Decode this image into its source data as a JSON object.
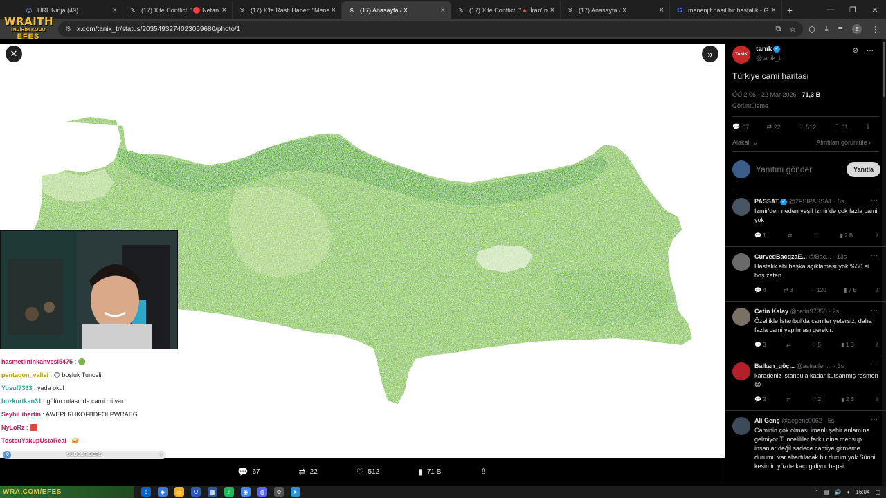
{
  "browser": {
    "tabs": [
      {
        "title": "URL Ninja (49)",
        "icon": "globe-icon",
        "active": false
      },
      {
        "title": "(17) X'te Conflict: \"🔴 Netanyahu",
        "icon": "x-icon",
        "active": false
      },
      {
        "title": "(17) X'te Rasti Haber: \"Menenjit",
        "icon": "x-icon",
        "active": false
      },
      {
        "title": "(17) Anasayfa / X",
        "icon": "x-icon",
        "active": true
      },
      {
        "title": "(17) X'te Conflict: \"🔺 İran'ın ba",
        "icon": "x-icon",
        "active": false
      },
      {
        "title": "(17) Anasayfa / X",
        "icon": "x-icon",
        "active": false
      },
      {
        "title": "menenjit nasıl bir hastalık - Goo",
        "icon": "google-icon",
        "active": false
      }
    ],
    "url": "x.com/tanik_tr/status/2035493274023059680/photo/1",
    "profile_initial": "E"
  },
  "overlay": {
    "brand_line1": "WRAITH",
    "brand_line2": "İNDİRİM KODU",
    "brand_line3": "EFES"
  },
  "media_actions": {
    "replies": "67",
    "reposts": "22",
    "likes": "512",
    "views": "71 B"
  },
  "post": {
    "author_name": "tanık",
    "author_handle": "@tanik_tr",
    "avatar_text": "TANIK",
    "text": "Türkiye cami haritası",
    "time": "ÖÖ 2:06 · 22 Mar 2026 · ",
    "views_count": "71,3 B",
    "views_label": "Görüntüleme",
    "replies": "67",
    "reposts": "22",
    "likes": "512",
    "bookmarks": "61",
    "sort_label": "Alakalı",
    "quotes_label": "Alıntıları görüntüle",
    "reply_placeholder": "Yanıtını gönder",
    "reply_button": "Yanıtla"
  },
  "replies": [
    {
      "name": "PASSAT",
      "handle": "@2FSIPASSAT · 6s",
      "verified": true,
      "text": "İzmir'den neden yeşil İzmir'de çok fazla cami yok",
      "replies": "1",
      "reposts": "",
      "likes": "",
      "views": "2 B",
      "avatar_color": "#4a5563"
    },
    {
      "name": "CurvedBacqzaE...",
      "handle": "@Bac... · 13s",
      "verified": false,
      "text": "Hastalık abi başka açıklaması yok.%50 si boş zaten",
      "replies": "4",
      "reposts": "3",
      "likes": "120",
      "views": "7 B",
      "avatar_color": "#6a6a6a"
    },
    {
      "name": "Çetin Kalay",
      "handle": "@cetin97358 · 2s",
      "verified": false,
      "text": "Özellikle İstanbul'da camiler yetersiz, daha fazla cami yapılması gerekir.",
      "replies": "3",
      "reposts": "",
      "likes": "5",
      "views": "1 B",
      "avatar_color": "#7a7066"
    },
    {
      "name": "Balkan_göç...",
      "handle": "@astralfen... · 3s",
      "verified": false,
      "text": "karadeniz istanbula kadar kutsanmış resmen 😁",
      "replies": "2",
      "reposts": "",
      "likes": "2",
      "views": "2 B",
      "avatar_color": "#b3202a"
    },
    {
      "name": "Ali Genç",
      "handle": "@aegenc0062 · 5s",
      "verified": false,
      "text": "Caminin çok olması imanlı şehir anlamına gelmiyor Tuncelililer farklı dine mensup insanlar değil sadece camiye gitmeme durumu  var abartılacak bir durum yok Sünni kesimin yüzde kaçı gidiyor hepsi",
      "replies": "",
      "reposts": "",
      "likes": "",
      "views": "",
      "avatar_color": "#3d4a5a"
    }
  ],
  "stream_chat": [
    {
      "user": "hasmetlininkahvesi5475",
      "message": ": 🟢",
      "color": "#c2185b"
    },
    {
      "user": "pentagon_valisi",
      "message": ": 😊 boşluk Tunceli",
      "color": "#b79a00"
    },
    {
      "user": "Yusuf7363",
      "message": ": yada okul",
      "color": "#2aa198"
    },
    {
      "user": "bozkurtkan31",
      "message": ": gölün ortasında cami mi var",
      "color": "#2aa198"
    },
    {
      "user": "SeyhiLibertin",
      "message": ": AWEPLRHKOFBDFOLPWRAEG",
      "color": "#c2185b"
    },
    {
      "user": "NyLoRz",
      "message": ": 🟥",
      "color": "#c2185b"
    },
    {
      "user": "TostcuYakupUstaReal",
      "message": ": 🥪",
      "color": "#c2185b"
    }
  ],
  "subscribers": {
    "label": "SUBSCRIBERS",
    "current": "0",
    "goal": "7",
    "progress": 0.05
  },
  "taskbar": {
    "promo": "WRA.COM/EFES",
    "time": "16:04"
  }
}
